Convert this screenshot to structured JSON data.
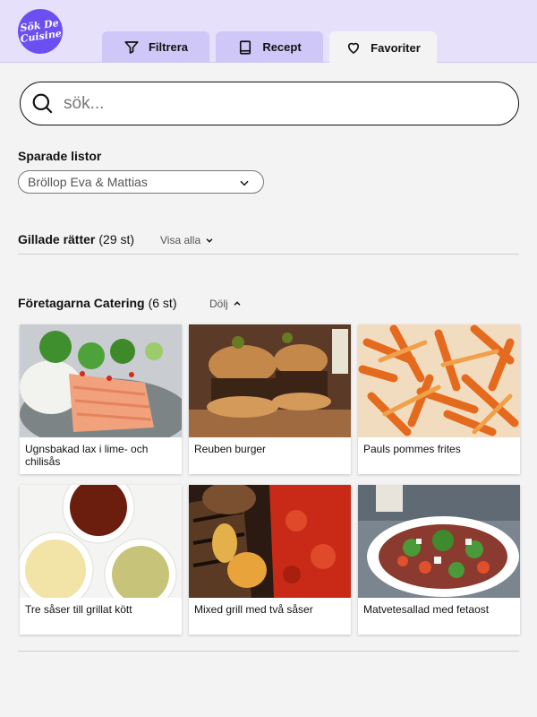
{
  "logo": {
    "text": "Sök De\nCuisine"
  },
  "tabs": [
    {
      "label": "Filtrera",
      "icon": "filter-icon"
    },
    {
      "label": "Recept",
      "icon": "book-icon"
    },
    {
      "label": "Favoriter",
      "icon": "heart-icon"
    }
  ],
  "search": {
    "placeholder": "sök..."
  },
  "saved_lists": {
    "label": "Sparade listor",
    "selected": "Bröllop Eva & Mattias"
  },
  "liked": {
    "title": "Gillade rätter",
    "count": "(29 st)",
    "toggle": "Visa alla"
  },
  "catering": {
    "title": "Företagarna Catering",
    "count": "(6 st)",
    "toggle": "Dölj"
  },
  "recipes": [
    {
      "name": "Ugnsbakad lax i lime- och chilisås",
      "image": "salmon-image"
    },
    {
      "name": "Reuben burger",
      "image": "burger-image"
    },
    {
      "name": "Pauls pommes frites",
      "image": "fries-image"
    },
    {
      "name": "Tre såser till grillat kött",
      "image": "sauces-image"
    },
    {
      "name": "Mixed grill med två såser",
      "image": "grill-image"
    },
    {
      "name": "Matvetesallad med fetaost",
      "image": "salad-image"
    }
  ],
  "colors": {
    "accent": "#6b4ff0",
    "header_bg": "#e6e0fb",
    "tab_inactive": "#cfc7f7",
    "page_bg": "#f3f3f3"
  }
}
